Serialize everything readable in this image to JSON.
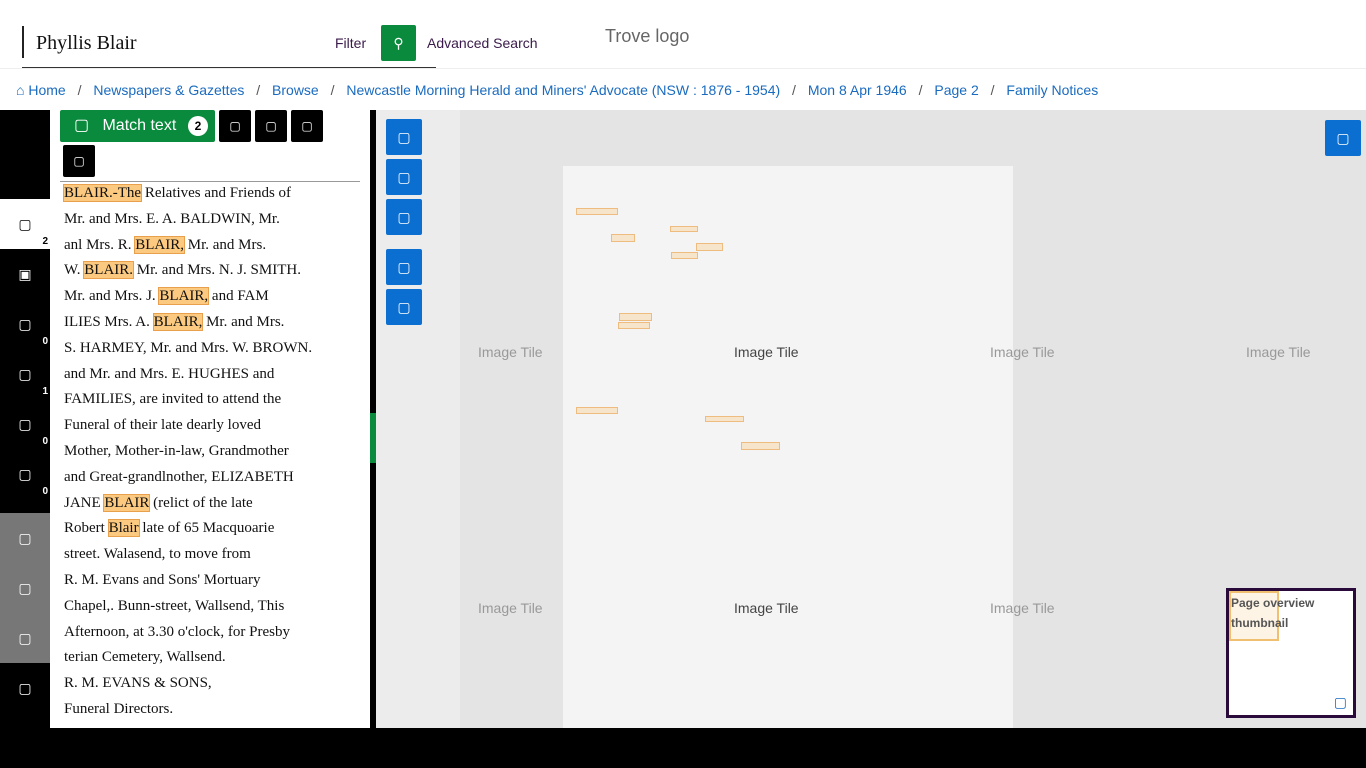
{
  "search": {
    "query": "Phyllis Blair",
    "filter_label": "Filter",
    "submit_icon": "search-icon",
    "advanced_label": "Advanced Search"
  },
  "logo": {
    "alt": "Trove logo"
  },
  "breadcrumb": {
    "home": "Home",
    "items": [
      "Newspapers & Gazettes",
      "Browse",
      "Newcastle Morning Herald and Miners' Advocate (NSW : 1876 - 1954)",
      "Mon 8 Apr 1946",
      "Page 2",
      "Family Notices"
    ],
    "separator": "/"
  },
  "rail": {
    "items": [
      {
        "icon": "article-icon",
        "count": "2"
      },
      {
        "icon": "image-icon",
        "count": ""
      },
      {
        "icon": "tag-icon",
        "count": "0"
      },
      {
        "icon": "comment-icon",
        "count": "1"
      },
      {
        "icon": "list-icon",
        "count": "0"
      },
      {
        "icon": "correction-icon",
        "count": "0"
      },
      {
        "icon": "cite-icon",
        "count": ""
      },
      {
        "icon": "download-icon",
        "count": ""
      },
      {
        "icon": "share-icon",
        "count": ""
      },
      {
        "icon": "help-icon",
        "count": ""
      }
    ]
  },
  "panel": {
    "match_label": "Match text",
    "match_count": "2",
    "ocr_lines": [
      [
        {
          "t": "BLAIR.-The",
          "h": true
        },
        {
          "t": " Relatives and Friends of",
          "h": false
        }
      ],
      [
        {
          "t": "Mr. and Mrs. E. A. BALDWIN, Mr.",
          "h": false
        }
      ],
      [
        {
          "t": "anl Mrs. R. ",
          "h": false
        },
        {
          "t": "BLAIR,",
          "h": true
        },
        {
          "t": " Mr. and Mrs.",
          "h": false
        }
      ],
      [
        {
          "t": "W. ",
          "h": false
        },
        {
          "t": "BLAIR.",
          "h": true
        },
        {
          "t": " Mr. and Mrs. N. J. SMITH.",
          "h": false
        }
      ],
      [
        {
          "t": "Mr. and Mrs. J. ",
          "h": false
        },
        {
          "t": "BLAIR,",
          "h": true
        },
        {
          "t": " and FAM",
          "h": false
        }
      ],
      [
        {
          "t": "ILIES Mrs. A. ",
          "h": false
        },
        {
          "t": "BLAIR,",
          "h": true
        },
        {
          "t": " Mr. and Mrs.",
          "h": false
        }
      ],
      [
        {
          "t": "S. HARMEY, Mr. and Mrs. W. BROWN.",
          "h": false
        }
      ],
      [
        {
          "t": "and Mr. and Mrs. E. HUGHES and",
          "h": false
        }
      ],
      [
        {
          "t": "FAMILIES, are invited to attend the",
          "h": false
        }
      ],
      [
        {
          "t": "Funeral of their late dearly loved",
          "h": false
        }
      ],
      [
        {
          "t": "Mother, Mother-in-law, Grandmother",
          "h": false
        }
      ],
      [
        {
          "t": "and Great-grandlnother, ELIZABETH",
          "h": false
        }
      ],
      [
        {
          "t": "JANE ",
          "h": false
        },
        {
          "t": "BLAIR",
          "h": true
        },
        {
          "t": " (relict of the late",
          "h": false
        }
      ],
      [
        {
          "t": "Robert ",
          "h": false
        },
        {
          "t": "Blair",
          "h": true
        },
        {
          "t": " late of 65 Macquoarie",
          "h": false
        }
      ],
      [
        {
          "t": "street. Walasend, to move from",
          "h": false
        }
      ],
      [
        {
          "t": "R. M. Evans and Sons' Mortuary",
          "h": false
        }
      ],
      [
        {
          "t": "Chapel,. Bunn-street, Wallsend, This",
          "h": false
        }
      ],
      [
        {
          "t": "Afternoon, at 3.30 o'clock, for Presby",
          "h": false
        }
      ],
      [
        {
          "t": "terian Cemetery, Wallsend.",
          "h": false
        }
      ],
      [
        {
          "t": "R. M. EVANS & SONS,",
          "h": false
        }
      ],
      [
        {
          "t": "Funeral Directors.",
          "h": false
        }
      ]
    ]
  },
  "viewer": {
    "tile_alt": "Image Tile",
    "overview_alt": "Page overview thumbnail"
  },
  "colors": {
    "accent_green": "#0a8a3c",
    "viewer_blue": "#0b6fd1",
    "highlight": "#fbc97f",
    "link": "#1a6bbf"
  }
}
